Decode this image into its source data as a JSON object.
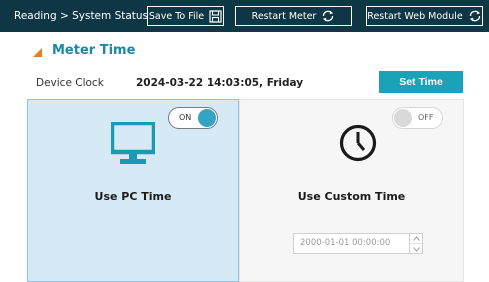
{
  "header": {
    "breadcrumb": "Reading > System Status",
    "save_label": "Save To File",
    "restart_meter_label": "Restart Meter",
    "restart_web_label": "Restart Web Module"
  },
  "section": {
    "title": "Meter Time"
  },
  "clock": {
    "label": "Device Clock",
    "value": "2024-03-22 14:03:05, Friday",
    "set_time_label": "Set Time"
  },
  "pc_card": {
    "toggle_label": "ON",
    "title": "Use PC Time",
    "selected": true
  },
  "custom_card": {
    "toggle_label": "OFF",
    "title": "Use Custom Time",
    "datetime_placeholder": "2000-01-01 00:00:00"
  },
  "colors": {
    "topbar": "#0f3645",
    "accent": "#1aa2b6",
    "section_title": "#1f86a6",
    "marker": "#e67e22"
  },
  "icons": [
    "save-icon",
    "refresh-icon",
    "monitor-icon",
    "clock-icon"
  ]
}
